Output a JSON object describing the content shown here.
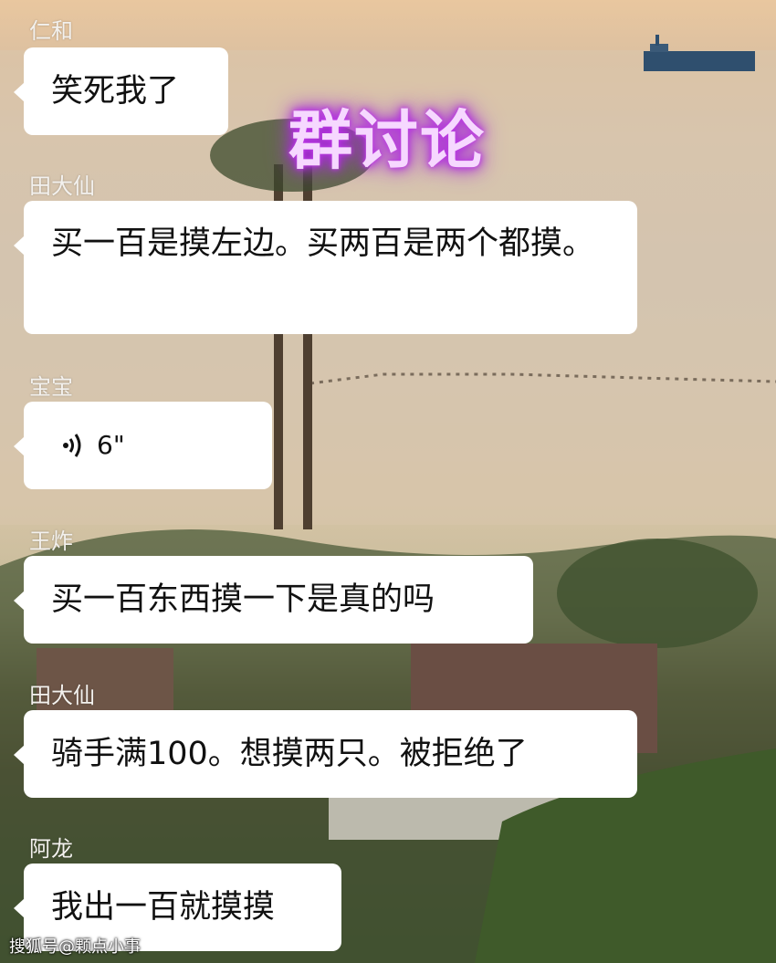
{
  "title": "群讨论",
  "messages": [
    {
      "sender": "仁和",
      "text": "笑死我了"
    },
    {
      "sender": "田大仙",
      "text": "买一百是摸左边。买两百是两个都摸。"
    },
    {
      "sender": "宝宝",
      "voice_duration": "6\""
    },
    {
      "sender": "王炸",
      "text": "买一百东西摸一下是真的吗"
    },
    {
      "sender": "田大仙",
      "text": "骑手满100。想摸两只。被拒绝了"
    },
    {
      "sender": "阿龙",
      "text": "我出一百就摸摸"
    }
  ],
  "footer": "搜狐号@颗点小事",
  "icons": {
    "voice": "voice-wave-icon"
  },
  "colors": {
    "bubble": "#ffffff",
    "title_glow": "#b02ee0"
  }
}
